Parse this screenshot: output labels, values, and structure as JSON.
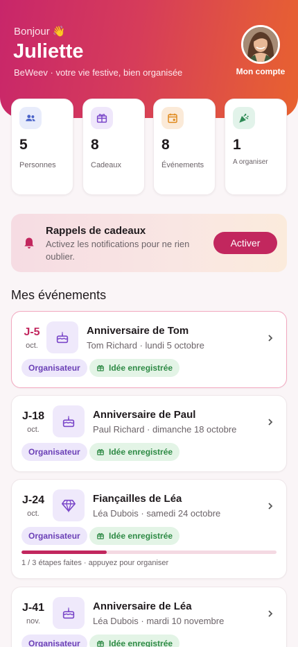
{
  "header": {
    "greeting": "Bonjour 👋",
    "user_name": "Juliette",
    "tagline": "BeWeev · votre vie festive, bien organisée",
    "account_label": "Mon compte"
  },
  "stats": [
    {
      "value": "5",
      "label": "Personnes",
      "icon": "people-icon"
    },
    {
      "value": "8",
      "label": "Cadeaux",
      "icon": "gift-icon"
    },
    {
      "value": "8",
      "label": "Événements",
      "icon": "calendar-icon"
    },
    {
      "value": "1",
      "label": "A organiser",
      "icon": "party-popper-icon"
    }
  ],
  "reminder": {
    "title": "Rappels de cadeaux",
    "subtitle": "Activez les notifications pour ne rien oublier.",
    "button": "Activer"
  },
  "section_title": "Mes événements",
  "events": [
    {
      "countdown": "J-5",
      "month": "oct.",
      "title": "Anniversaire de Tom",
      "subtitle": "Tom Richard · lundi 5 octobre",
      "icon": "cake-icon",
      "chip_role": "Organisateur",
      "chip_idea": "Idée enregistrée",
      "highlighted": true
    },
    {
      "countdown": "J-18",
      "month": "oct.",
      "title": "Anniversaire de Paul",
      "subtitle": "Paul Richard · dimanche 18 octobre",
      "icon": "cake-icon",
      "chip_role": "Organisateur",
      "chip_idea": "Idée enregistrée"
    },
    {
      "countdown": "J-24",
      "month": "oct.",
      "title": "Fiançailles de Léa",
      "subtitle": "Léa Dubois · samedi 24 octobre",
      "icon": "diamond-icon",
      "chip_role": "Organisateur",
      "chip_idea": "Idée enregistrée",
      "progress": 0.333,
      "progress_text": "1 / 3 étapes faites · appuyez pour organiser"
    },
    {
      "countdown": "J-41",
      "month": "nov.",
      "title": "Anniversaire de Léa",
      "subtitle": "Léa Dubois · mardi 10 novembre",
      "icon": "cake-icon",
      "chip_role": "Organisateur",
      "chip_idea": "Idée enregistrée"
    }
  ],
  "colors": {
    "accent": "#c2275e",
    "hero_start": "#c8266a",
    "hero_end": "#e8622f",
    "chip_role_bg": "#ede7fb",
    "chip_idea_bg": "#e3f4e6"
  }
}
